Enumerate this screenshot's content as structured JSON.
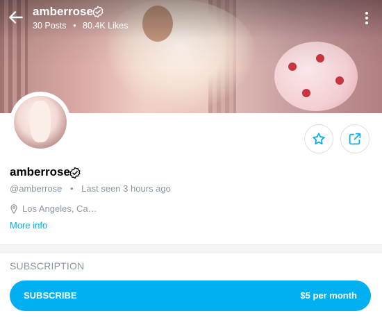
{
  "header": {
    "username": "amberrose",
    "posts": "30 Posts",
    "separator": "•",
    "likes": "80.4K Likes"
  },
  "profile": {
    "name": "amberrose",
    "handle": "@amberrose",
    "separator": "•",
    "last_seen": "Last seen 3 hours ago",
    "location": "Los Angeles, Ca…",
    "more_info": "More info"
  },
  "subscription": {
    "heading": "SUBSCRIPTION",
    "button_label": "SUBSCRIBE",
    "price": "$5 per month"
  },
  "colors": {
    "accent": "#00aff0",
    "muted_text": "#8a96a3"
  },
  "icons": [
    "back-arrow-icon",
    "verified-icon",
    "more-vertical-icon",
    "star-icon",
    "share-icon",
    "location-pin-icon"
  ]
}
